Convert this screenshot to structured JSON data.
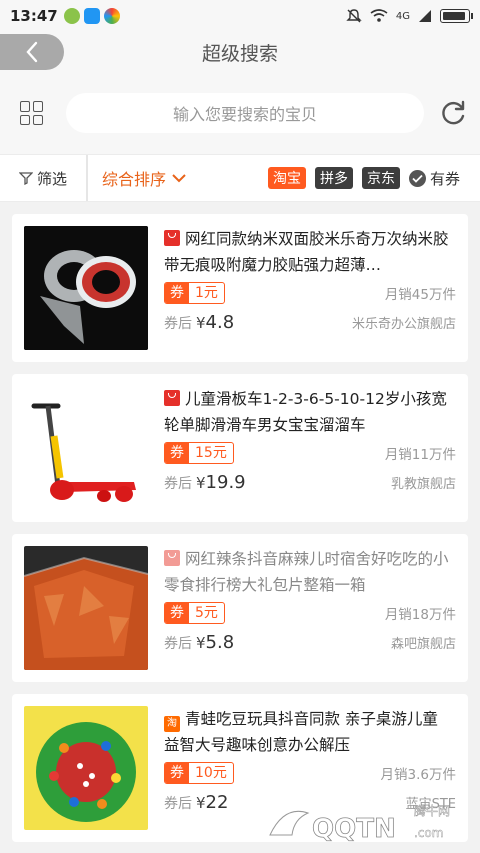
{
  "statusbar": {
    "time": "13:47",
    "network": "4G"
  },
  "header": {
    "title": "超级搜索"
  },
  "search": {
    "placeholder": "输入您要搜索的宝贝"
  },
  "filters": {
    "filter_label": "筛选",
    "sort_label": "综合排序",
    "platforms": [
      "淘宝",
      "拼多",
      "京东"
    ],
    "active_platform": "淘宝",
    "coupon_label": "有券"
  },
  "colors": {
    "accent": "#ff5a1f",
    "sort": "#e8631a",
    "tmall": "#e5302a"
  },
  "products": [
    {
      "title": "网红同款纳米双面胶米乐奇万次纳米胶带无痕吸附魔力胶贴强力超薄…",
      "source_icon": "tmall-icon",
      "coupon_label": "券",
      "coupon_value": "1元",
      "sales": "月销45万件",
      "after_label": "券后",
      "currency": "¥",
      "price": "4.8",
      "store": "米乐奇办公旗舰店"
    },
    {
      "title": "儿童滑板车1-2-3-6-5-10-12岁小孩宽轮单脚滑滑车男女宝宝溜溜车",
      "source_icon": "tmall-icon",
      "coupon_label": "券",
      "coupon_value": "15元",
      "sales": "月销11万件",
      "after_label": "券后",
      "currency": "¥",
      "price": "19.9",
      "store": "乳教旗舰店"
    },
    {
      "title": "网红辣条抖音麻辣儿时宿舍好吃吃的小零食排行榜大礼包片整箱一箱",
      "source_icon": "tmall-icon",
      "coupon_label": "券",
      "coupon_value": "5元",
      "sales": "月销18万件",
      "after_label": "券后",
      "currency": "¥",
      "price": "5.8",
      "store": "森吧旗舰店"
    },
    {
      "title": "青蛙吃豆玩具抖音同款 亲子桌游儿童 益智大号趣味创意办公解压",
      "source_icon": "taobao-icon",
      "source_text": "淘",
      "coupon_label": "券",
      "coupon_value": "10元",
      "sales": "月销3.6万件",
      "after_label": "券后",
      "currency": "¥",
      "price": "22",
      "store": "蓝宙STE"
    }
  ],
  "watermark": {
    "text": "QQTN.com",
    "cn": "腾牛网"
  }
}
